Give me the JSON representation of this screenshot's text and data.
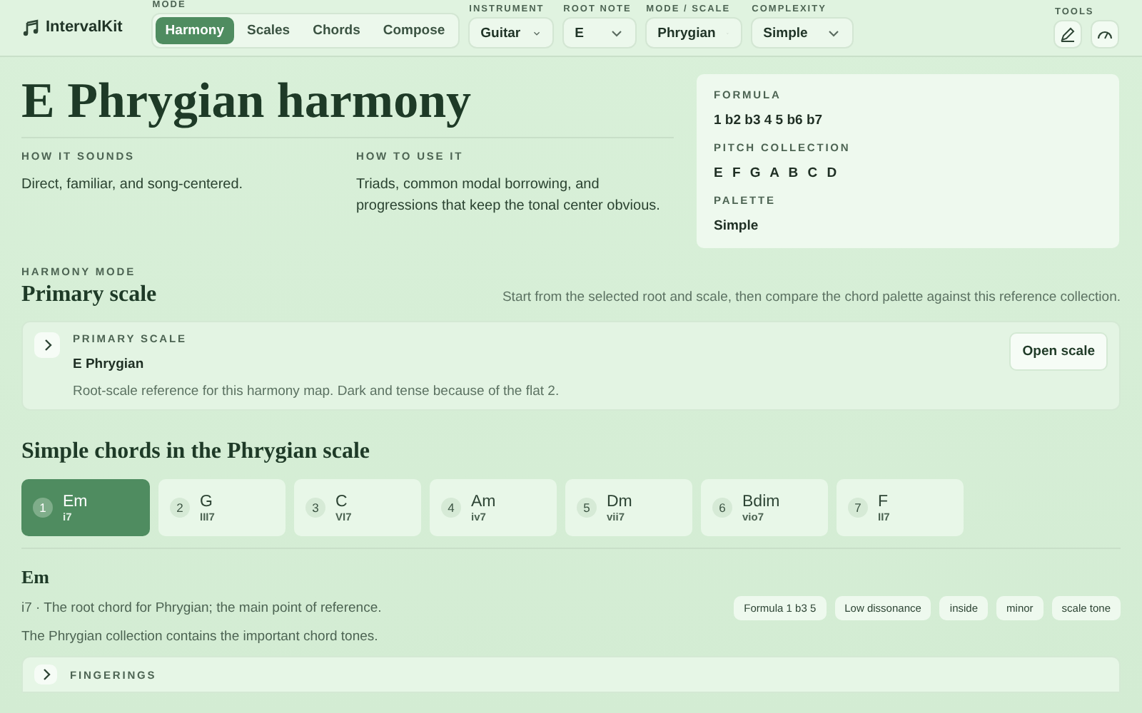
{
  "app": {
    "name": "IntervalKit"
  },
  "mode": {
    "label": "MODE",
    "tabs": [
      {
        "label": "Harmony",
        "selected": true
      },
      {
        "label": "Scales",
        "selected": false
      },
      {
        "label": "Chords",
        "selected": false
      },
      {
        "label": "Compose",
        "selected": false
      }
    ]
  },
  "selects": [
    {
      "label": "INSTRUMENT",
      "value": "Guitar"
    },
    {
      "label": "ROOT NOTE",
      "value": "E"
    },
    {
      "label": "MODE / SCALE",
      "value": "Phrygian"
    },
    {
      "label": "COMPLEXITY",
      "value": "Simple"
    }
  ],
  "tools": {
    "label": "TOOLS"
  },
  "hero": {
    "title": "E Phrygian harmony",
    "columns": [
      {
        "heading": "HOW IT SOUNDS",
        "text": "Direct, familiar, and song-centered."
      },
      {
        "heading": "HOW TO USE IT",
        "text": "Triads, common modal borrowing, and progressions that keep the tonal center obvious."
      }
    ],
    "facts": [
      {
        "label": "FORMULA",
        "value": "1 b2 b3 4 5 b6 b7"
      },
      {
        "label": "PITCH COLLECTION",
        "value": "E F G A B C D"
      },
      {
        "label": "PALETTE",
        "value": "Simple"
      }
    ]
  },
  "harmony": {
    "eyebrow": "HARMONY MODE",
    "title": "Primary scale",
    "note": "Start from the selected root and scale, then compare the chord palette against this reference collection."
  },
  "primary_card": {
    "eyebrow": "PRIMARY SCALE",
    "title": "E Phrygian",
    "text": "Root-scale reference for this harmony map. Dark and tense because of the flat 2.",
    "button": "Open scale"
  },
  "chords": {
    "title": "Simple chords in the Phrygian scale",
    "items": [
      {
        "number": "1",
        "name": "Em",
        "numeral": "i7",
        "selected": true
      },
      {
        "number": "2",
        "name": "G",
        "numeral": "III7",
        "selected": false
      },
      {
        "number": "3",
        "name": "C",
        "numeral": "VI7",
        "selected": false
      },
      {
        "number": "4",
        "name": "Am",
        "numeral": "iv7",
        "selected": false
      },
      {
        "number": "5",
        "name": "Dm",
        "numeral": "vii7",
        "selected": false
      },
      {
        "number": "6",
        "name": "Bdim",
        "numeral": "vio7",
        "selected": false
      },
      {
        "number": "7",
        "name": "F",
        "numeral": "II7",
        "selected": false
      }
    ]
  },
  "detail": {
    "title": "Em",
    "summary": "i7 · The root chord for Phrygian; the main point of reference.",
    "tags": [
      "Formula 1 b3 5",
      "Low dissonance",
      "inside",
      "minor",
      "scale tone"
    ],
    "note": "The Phrygian collection contains the important chord tones."
  },
  "fingerings": {
    "eyebrow": "FINGERINGS"
  }
}
